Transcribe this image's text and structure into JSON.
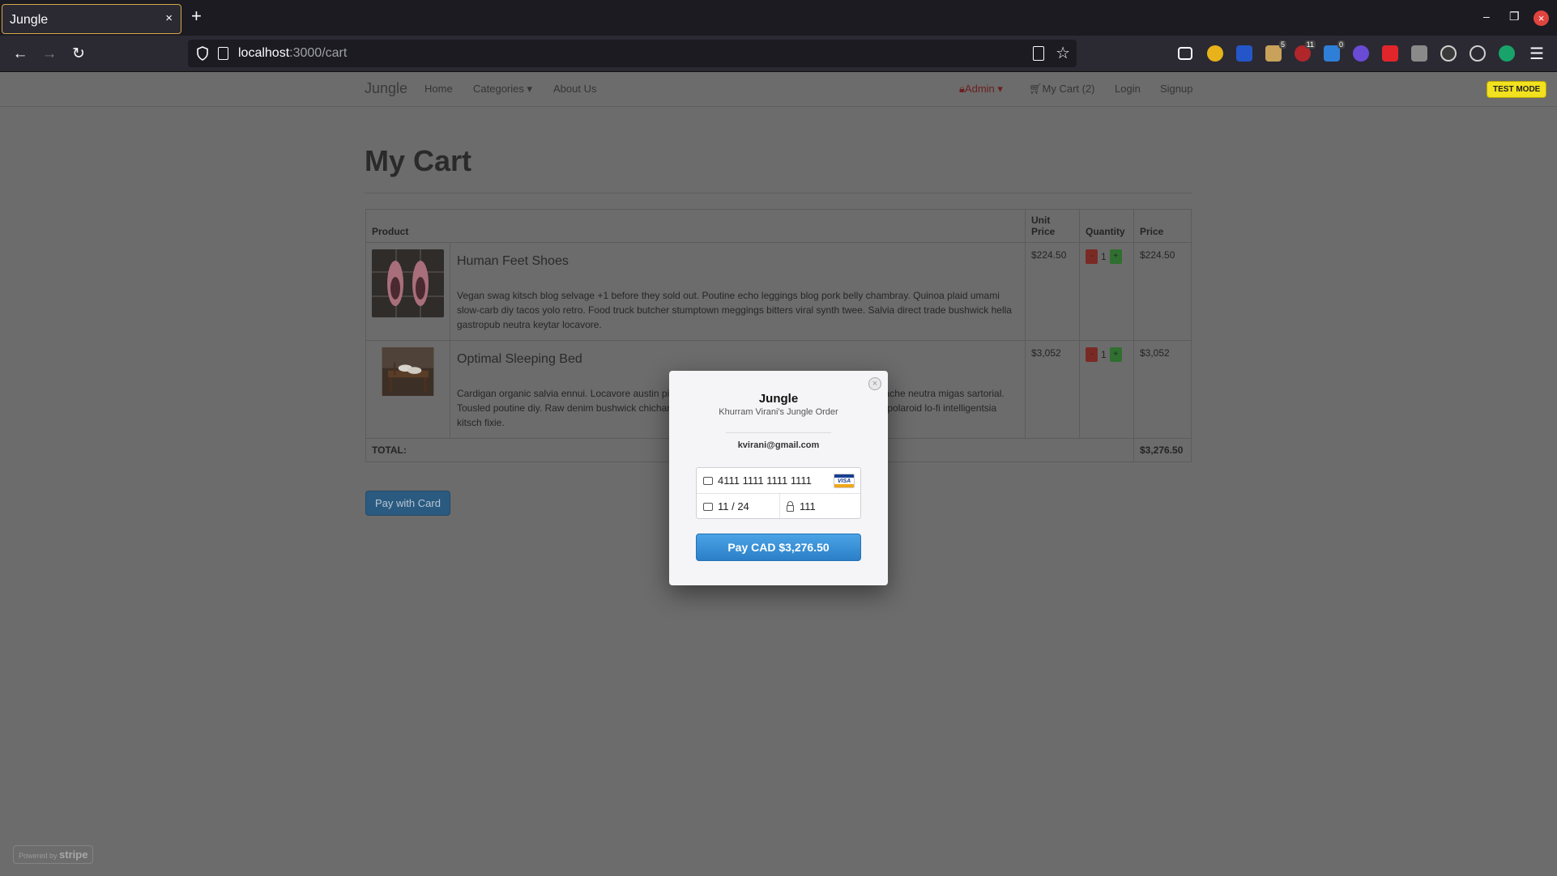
{
  "browser": {
    "tab_title": "Jungle",
    "tab_close": "×",
    "new_tab": "+",
    "url_host": "localhost",
    "url_path": ":3000/cart",
    "extension_badges": [
      "5",
      "11",
      "0"
    ]
  },
  "site": {
    "brand": "Jungle",
    "nav": {
      "home": "Home",
      "categories": "Categories ▾",
      "about": "About Us",
      "admin": "Admin ▾",
      "cart": "My Cart (2)",
      "login": "Login",
      "signup": "Signup"
    },
    "test_mode": "TEST MODE"
  },
  "cart": {
    "title": "My Cart",
    "headers": {
      "product": "Product",
      "unit_price": "Unit Price",
      "quantity": "Quantity",
      "price": "Price"
    },
    "items": [
      {
        "name": "Human Feet Shoes",
        "description": "Vegan swag kitsch blog selvage +1 before they sold out. Poutine echo leggings blog pork belly chambray. Quinoa plaid umami slow-carb diy tacos yolo retro. Food truck butcher stumptown meggings bitters viral synth twee. Salvia direct trade bushwick hella gastropub neutra keytar locavore.",
        "unit_price": "$224.50",
        "quantity": "1",
        "price": "$224.50"
      },
      {
        "name": "Optimal Sleeping Bed",
        "description": "Cardigan organic salvia ennui. Locavore austin pinterest shoreditch intelligentsia cardigan vhs mustache neutra migas sartorial. Tousled poutine diy. Raw denim bushwick chicharrones tousled selfies banh mi cray beard heirloom polaroid lo-fi intelligentsia kitsch fixie.",
        "unit_price": "$3,052",
        "quantity": "1",
        "price": "$3,052"
      }
    ],
    "minus_label": "-",
    "plus_label": "+",
    "total_label": "TOTAL:",
    "total_value": "$3,276.50",
    "pay_button": "Pay with Card"
  },
  "stripe_badge": {
    "powered_by": "Powered by",
    "brand": "stripe"
  },
  "checkout_modal": {
    "title": "Jungle",
    "subtitle": "Khurram Virani's Jungle Order",
    "email": "kvirani@gmail.com",
    "card_number": "4111 1111 1111 1111",
    "card_brand": "VISA",
    "expiry": "11 / 24",
    "cvc": "111",
    "pay_label": "Pay CAD $3,276.50",
    "close": "×"
  },
  "colors": {
    "overlay_page": "#6c6c6c",
    "pay_button": "#2b7fc7",
    "test_mode": "#f2e11f"
  }
}
